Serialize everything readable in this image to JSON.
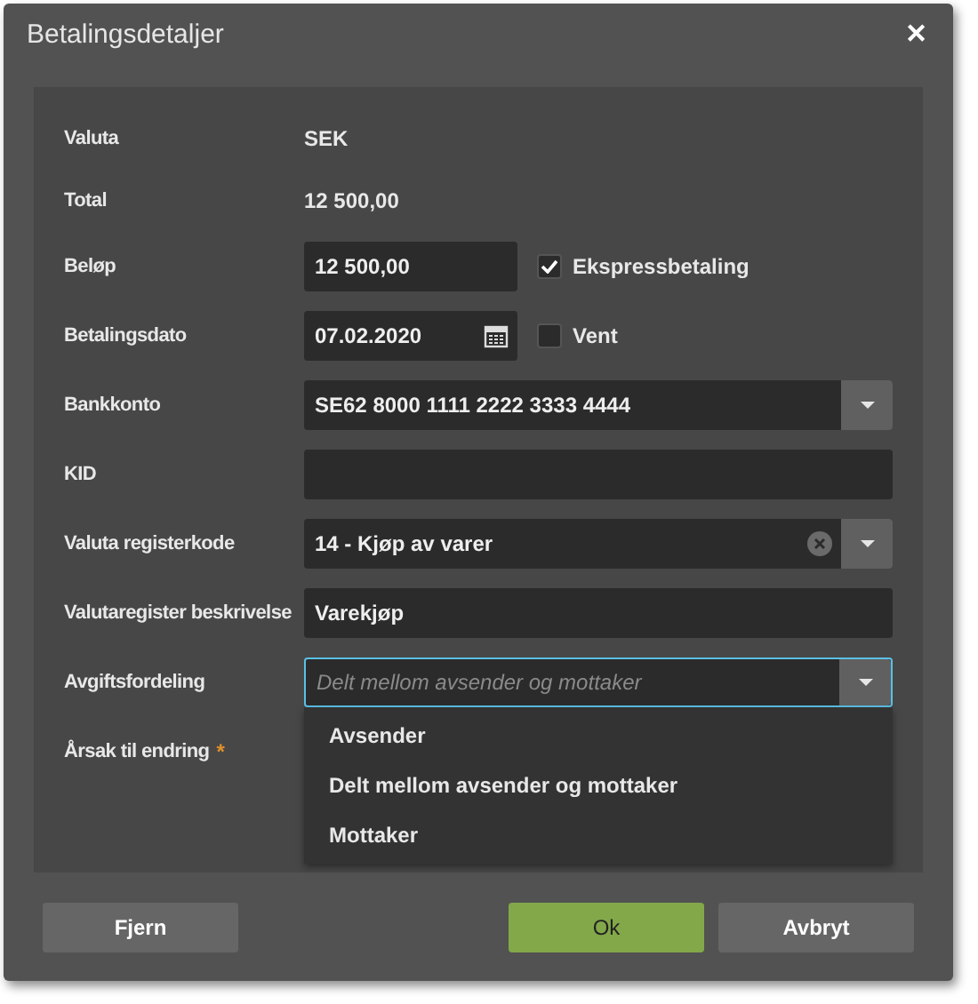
{
  "window": {
    "title": "Betalingsdetaljer",
    "close": "✕"
  },
  "rows": [
    {
      "label": "Valuta",
      "kind": "text",
      "value": "SEK"
    },
    {
      "label": "Total",
      "kind": "text",
      "value": "12 500,00"
    },
    {
      "label": "Beløp",
      "kind": "input",
      "value": "12 500,00",
      "checkbox": {
        "label": "Ekspressbetaling",
        "checked": true
      }
    },
    {
      "label": "Betalingsdato",
      "kind": "date",
      "value": "07.02.2020",
      "checkbox": {
        "label": "Vent",
        "checked": false
      }
    },
    {
      "label": "Bankkonto",
      "kind": "select",
      "value": "SE62 8000 1111 2222 3333 4444"
    },
    {
      "label": "KID",
      "kind": "wide-input"
    },
    {
      "label": "Valuta registerkode",
      "kind": "clearable-select",
      "value": "14 - Kjøp av varer"
    },
    {
      "label": "Valutaregister beskrivelse",
      "kind": "wide-input",
      "value": "Varekjøp"
    },
    {
      "label": "Avgiftsfordeling",
      "kind": "select",
      "placeholder": "Delt mellom avsender og mottaker",
      "focused": true,
      "options": [
        "Avsender",
        "Delt mellom avsender og mottaker",
        "Mottaker"
      ]
    },
    {
      "label": "Årsak til endring",
      "kind": "label-only",
      "required": "*"
    }
  ],
  "buttons": [
    {
      "label": "Fjern",
      "kind": "secondary"
    },
    {
      "label": "Ok",
      "kind": "primary"
    },
    {
      "label": "Avbryt",
      "kind": "secondary"
    }
  ]
}
